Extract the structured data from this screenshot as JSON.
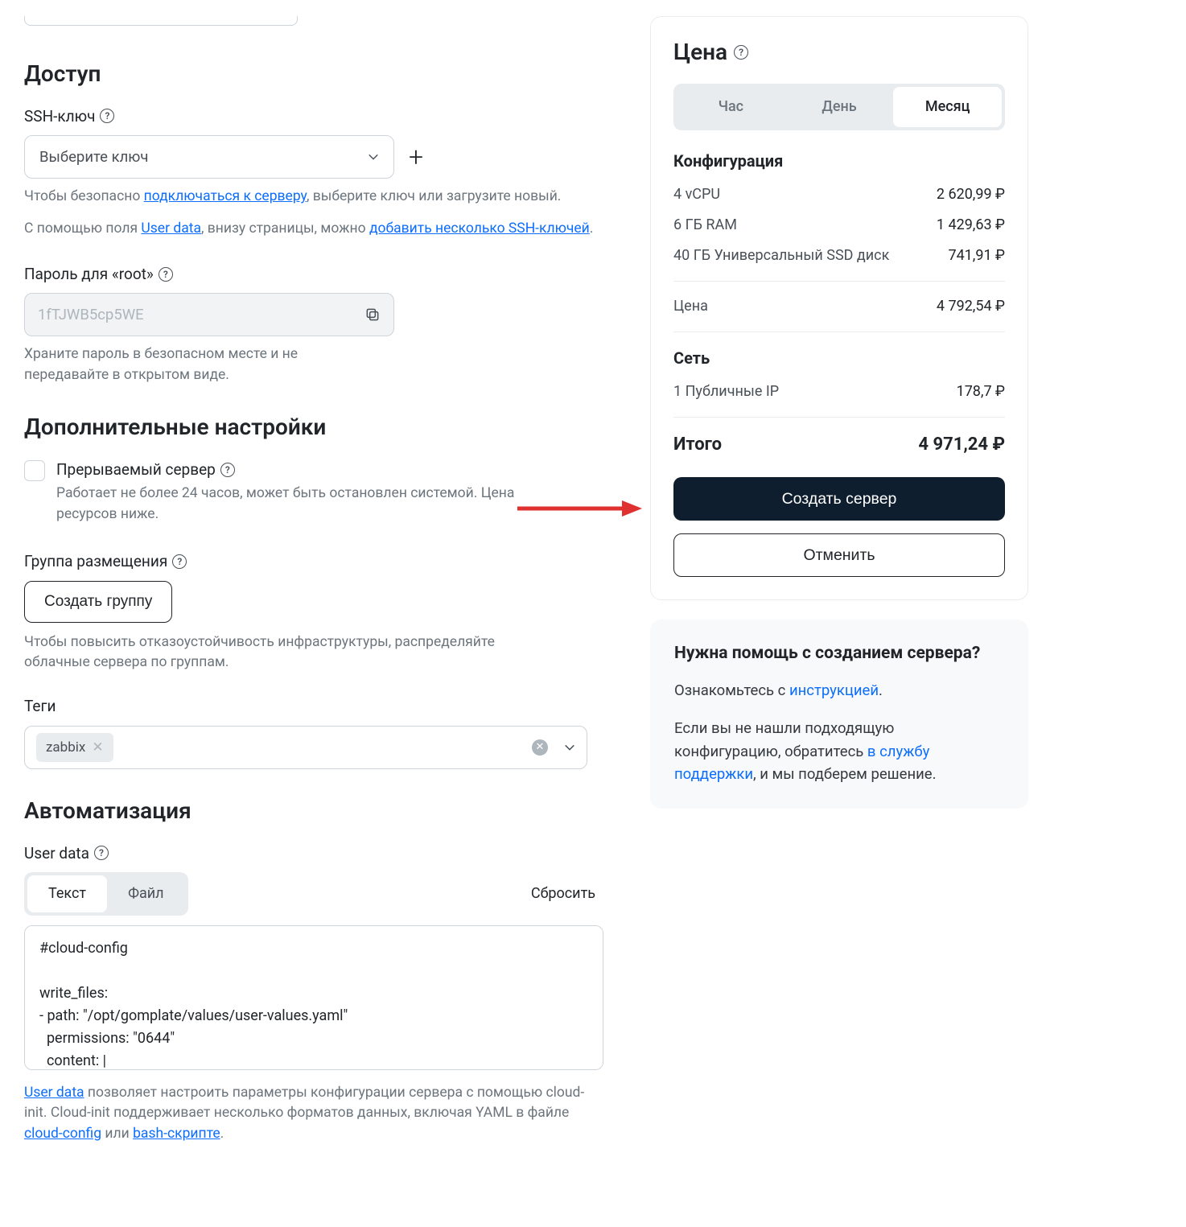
{
  "access": {
    "heading": "Доступ",
    "ssh_label": "SSH-ключ",
    "ssh_placeholder": "Выберите ключ",
    "hint1_pre": "Чтобы безопасно ",
    "hint1_link": "подключаться к серверу",
    "hint1_post": ", выберите ключ или загрузите новый.",
    "hint2_pre": "С помощью поля ",
    "hint2_link": "User data",
    "hint2_mid": ", внизу страницы, можно ",
    "hint2_link2": "добавить несколько SSH-ключей",
    "hint2_post": ".",
    "root_label": "Пароль для «root»",
    "root_value": "1fTJWB5cp5WE",
    "root_hint": "Храните пароль в безопасном месте и не передавайте в открытом виде."
  },
  "extra": {
    "heading": "Дополнительные настройки",
    "preempt_label": "Прерываемый сервер",
    "preempt_hint": "Работает не более 24 часов, может быть остановлен системой. Цена ресурсов ниже.",
    "group_label": "Группа размещения",
    "group_btn": "Создать группу",
    "group_hint": "Чтобы повысить отказоустойчивость инфраструктуры, распределяйте облачные сервера по группам.",
    "tags_label": "Теги",
    "tag_value": "zabbix"
  },
  "auto": {
    "heading": "Автоматизация",
    "ud_label": "User data",
    "tab_text": "Текст",
    "tab_file": "Файл",
    "reset": "Сбросить",
    "textarea": "#cloud-config\n\nwrite_files:\n- path: \"/opt/gomplate/values/user-values.yaml\"\n  permissions: \"0644\"\n  content: |",
    "ud_hint_link1": "User data",
    "ud_hint_mid1": " позволяет настроить параметры конфигурации сервера с помощью cloud-init. Cloud-init поддерживает несколько форматов данных, включая YAML в файле ",
    "ud_hint_link2": "cloud-config",
    "ud_hint_mid2": " или ",
    "ud_hint_link3": "bash-скрипте",
    "ud_hint_post": "."
  },
  "price": {
    "title": "Цена",
    "tab_hour": "Час",
    "tab_day": "День",
    "tab_month": "Месяц",
    "config_head": "Конфигурация",
    "rows": [
      {
        "name": "4 vCPU",
        "val": "2 620,99 ₽"
      },
      {
        "name": "6 ГБ RAM",
        "val": "1 429,63 ₽"
      },
      {
        "name": "40 ГБ Универсальный SSD диск",
        "val": "741,91 ₽"
      }
    ],
    "price_lbl": "Цена",
    "price_val": "4 792,54 ₽",
    "net_head": "Сеть",
    "net_rows": [
      {
        "name": "1 Публичные IP",
        "val": "178,7 ₽"
      }
    ],
    "total_lbl": "Итого",
    "total_val": "4 971,24 ₽",
    "create_btn": "Создать сервер",
    "cancel_btn": "Отменить"
  },
  "help_card": {
    "title": "Нужна помощь с созданием сервера?",
    "p1_pre": "Ознакомьтесь с ",
    "p1_link": "инструкцией",
    "p1_post": ".",
    "p2_pre": "Если вы не нашли подходящую конфигурацию, обратитесь ",
    "p2_link": "в службу поддержки",
    "p2_post": ", и мы подберем решение."
  }
}
